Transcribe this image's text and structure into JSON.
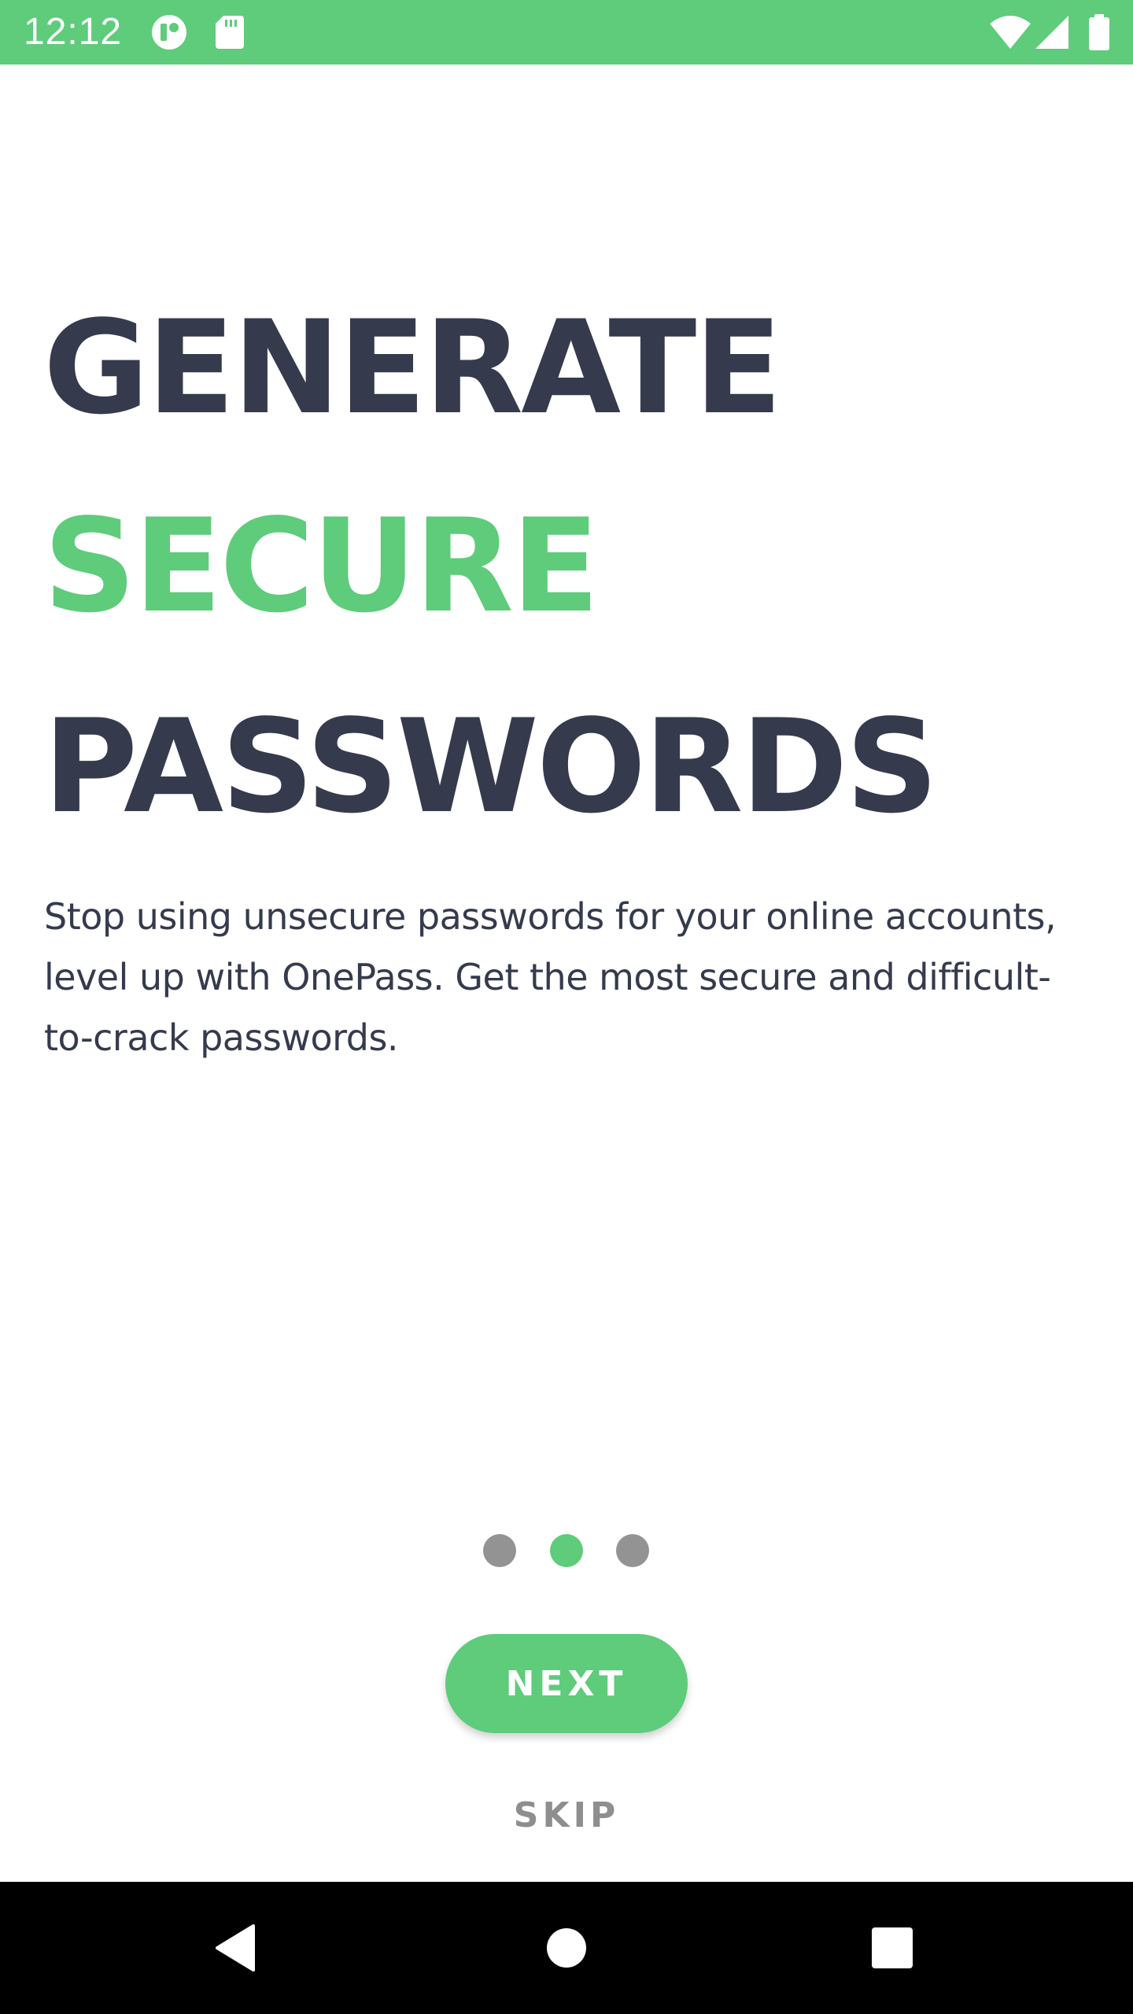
{
  "status_bar": {
    "time": "12:12",
    "background_color": "#5ecc7b",
    "icons": [
      "app-notification-icon",
      "sd-card-icon",
      "wifi-icon",
      "cellular-signal-icon",
      "battery-icon"
    ]
  },
  "onboarding": {
    "headline_line_1": "GENERATE",
    "headline_line_2": "SECURE",
    "headline_line_3": "PASSWORDS",
    "description": "Stop using unsecure passwords for your online accounts, level up with OnePass. Get the most secure and difficult-to-crack passwords.",
    "accent_color": "#5ecc7b",
    "text_color": "#353a4d"
  },
  "page_indicator": {
    "total_pages": 3,
    "active_page": 2
  },
  "actions": {
    "next_label": "NEXT",
    "skip_label": "SKIP"
  },
  "navigation_bar": {
    "icons": [
      "back-icon",
      "home-icon",
      "recents-icon"
    ]
  }
}
